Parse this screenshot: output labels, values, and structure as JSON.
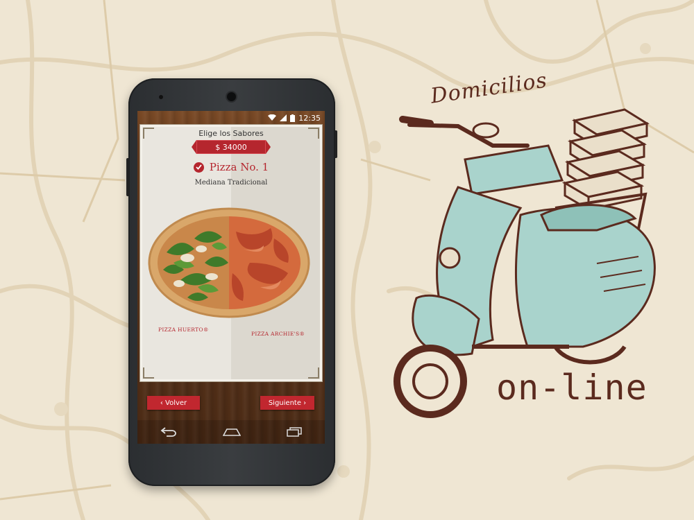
{
  "status_bar": {
    "time": "12:35"
  },
  "card": {
    "title": "Elige los Sabores",
    "price": "$ 34000",
    "pizza_name": "Pizza No. 1",
    "pizza_size": "Mediana Tradicional",
    "flavor_left": "PIZZA HUERTO®",
    "flavor_right": "PIZZA ARCHIE'S®"
  },
  "buttons": {
    "back": "‹ Volver",
    "next": "Siguiente ›"
  },
  "navbar": {
    "icons": [
      "back-icon",
      "home-icon",
      "recent-apps-icon"
    ]
  },
  "branding": {
    "top_text": "Domicilios",
    "bottom_text": "on-line"
  },
  "colors": {
    "accent_red": "#b5262e",
    "mint": "#a9d3cc",
    "ink_brown": "#5b2a1e"
  }
}
